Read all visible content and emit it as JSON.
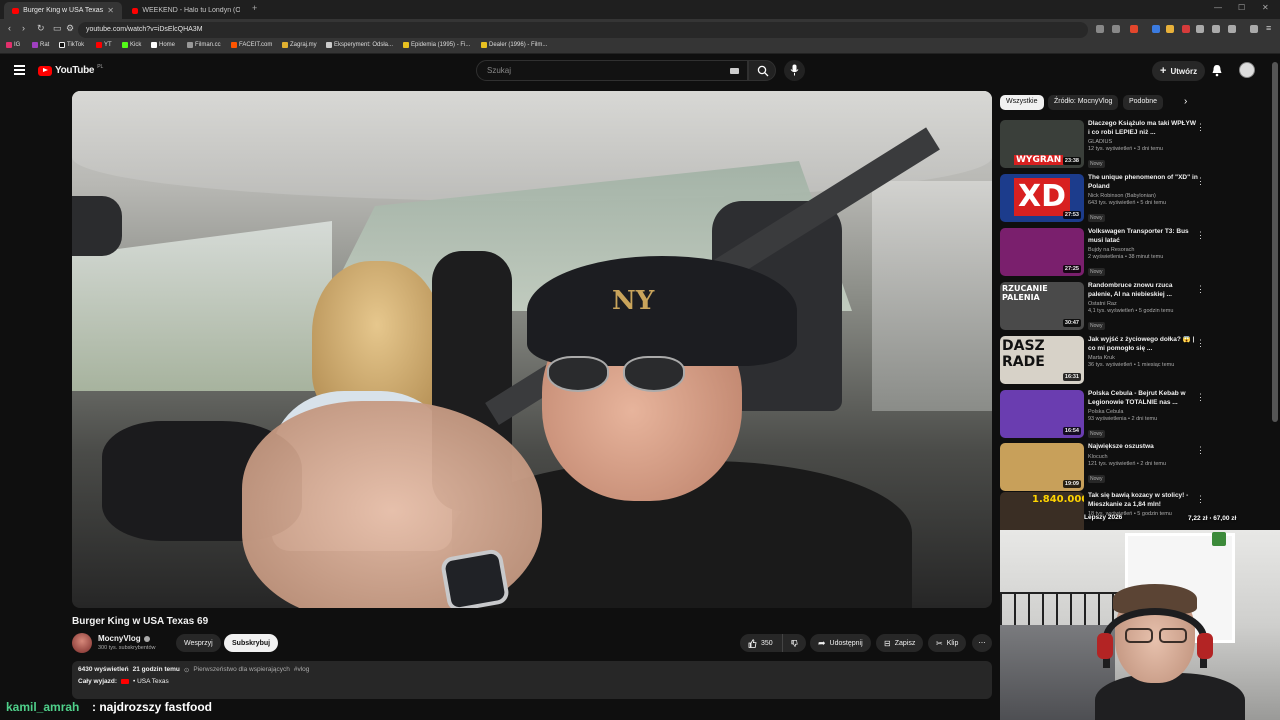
{
  "browser": {
    "tabs": [
      {
        "label": "Burger King w USA Texas 69",
        "active": true
      },
      {
        "label": "WEEKEND - Halo tu Londyn (Oficjaln...",
        "active": false
      }
    ],
    "url": "youtube.com/watch?v=iDsElcQHA3M",
    "bookmarks": [
      "IG",
      "Rat",
      "TikTok",
      "YT",
      "Kick",
      "Home",
      "Filman.cc",
      "FACEIT.com",
      "Zagraj.my",
      "Eksperyment: Odsła...",
      "Epidemia (1995) - Fi...",
      "Dealer (1996) - Film..."
    ]
  },
  "header": {
    "logo_text": "YouTube",
    "logo_region": "PL",
    "search_placeholder": "Szukaj",
    "create_label": "Utwórz"
  },
  "video": {
    "title": "Burger King w USA Texas 69",
    "cap_logo": "NY",
    "channel_name": "MocnyVlog",
    "channel_subs": "300 tys. subskrybentów",
    "support_label": "Wesprzyj",
    "subscribe_label": "Subskrybuj",
    "like_count": "350",
    "share_label": "Udostępnij",
    "save_label": "Zapisz",
    "clip_label": "Klip",
    "views": "6430 wyświetleń",
    "time_ago": "21 godzin temu",
    "priority_note": "Pierwszeństwo dla wspierających",
    "hashtag": "#vlog",
    "playlist_prefix": "Cały wyjazd:",
    "playlist_name": "USA Texas"
  },
  "chips": [
    "Wszystkie",
    "Źródło: MocnyVlog",
    "Podobne"
  ],
  "recommendations": [
    {
      "title": "Dlaczego Książulo ma taki WPŁYW i co robi LEPIEJ niż ...",
      "channel": "GLADIUS",
      "meta": "12 tys. wyświetleń • 3 dni temu",
      "badge": "Nowy",
      "duration": "23:38",
      "thumb_text": "WYGRAN",
      "thumb_bg": "#3a3f3a"
    },
    {
      "title": "The unique phenomenon of \"XD\" in Poland",
      "channel": "Nick Robinson (Babylonian)",
      "meta": "643 tys. wyświetleń • 5 dni temu",
      "badge": "Nowy",
      "duration": "27:53",
      "thumb_text": "XD",
      "thumb_bg": "#1c3c8c"
    },
    {
      "title": "Volkswagen Transporter T3: Bus musi latać",
      "channel": "Bujdy na Resorach",
      "meta": "2 wyświetlenia • 38 minut temu",
      "badge": "Nowy",
      "duration": "27:25",
      "thumb_text": "",
      "thumb_bg": "#7a1f6d"
    },
    {
      "title": "Randombruce znowu rzuca palenie, AI na niebieskiej ...",
      "channel": "Ostatni Raz",
      "meta": "4,1 tys. wyświetleń • 5 godzin temu",
      "badge": "Nowy",
      "duration": "30:47",
      "thumb_text": "RZUCANIE PALENIA",
      "thumb_bg": "#4a4a4a"
    },
    {
      "title": "Jak wyjść z życiowego dołka? 😱 | co mi pomogło się ...",
      "channel": "Marta Kruk",
      "meta": "36 tys. wyświetleń • 1 miesiąc temu",
      "badge": "",
      "duration": "16:31",
      "thumb_text": "DASZ RADE",
      "thumb_bg": "#d7d2c8"
    },
    {
      "title": "Polska Cebula - Bejrut Kebab w Legionowie TOTALNIE nas ...",
      "channel": "Polska Cebula",
      "meta": "93 wyświetlenia • 2 dni temu",
      "badge": "Nowy",
      "duration": "16:54",
      "thumb_text": "",
      "thumb_bg": "#6a3db0"
    },
    {
      "title": "Największe oszustwa",
      "channel": "Klocuch",
      "meta": "121 tys. wyświetleń • 2 dni temu",
      "badge": "Nowy",
      "duration": "19:09",
      "thumb_text": "",
      "thumb_bg": "#c8a05a"
    },
    {
      "title": "Tak się bawią kozacy w stolicy! - Mieszkanie za 1,84 mln!",
      "channel": "",
      "meta": "18 tys. wyświetleń • 5 godzin temu",
      "badge": "",
      "duration": "",
      "thumb_text": "1.840.000",
      "thumb_bg": "#3a2e24"
    }
  ],
  "overlay": {
    "ticker_left": "Lepszy 2026",
    "ticker_right": "7,22 zł ⋅ 67,00 zł",
    "chat_user": "kamil_amrah",
    "chat_message": ": najdrozszy fastfood"
  }
}
